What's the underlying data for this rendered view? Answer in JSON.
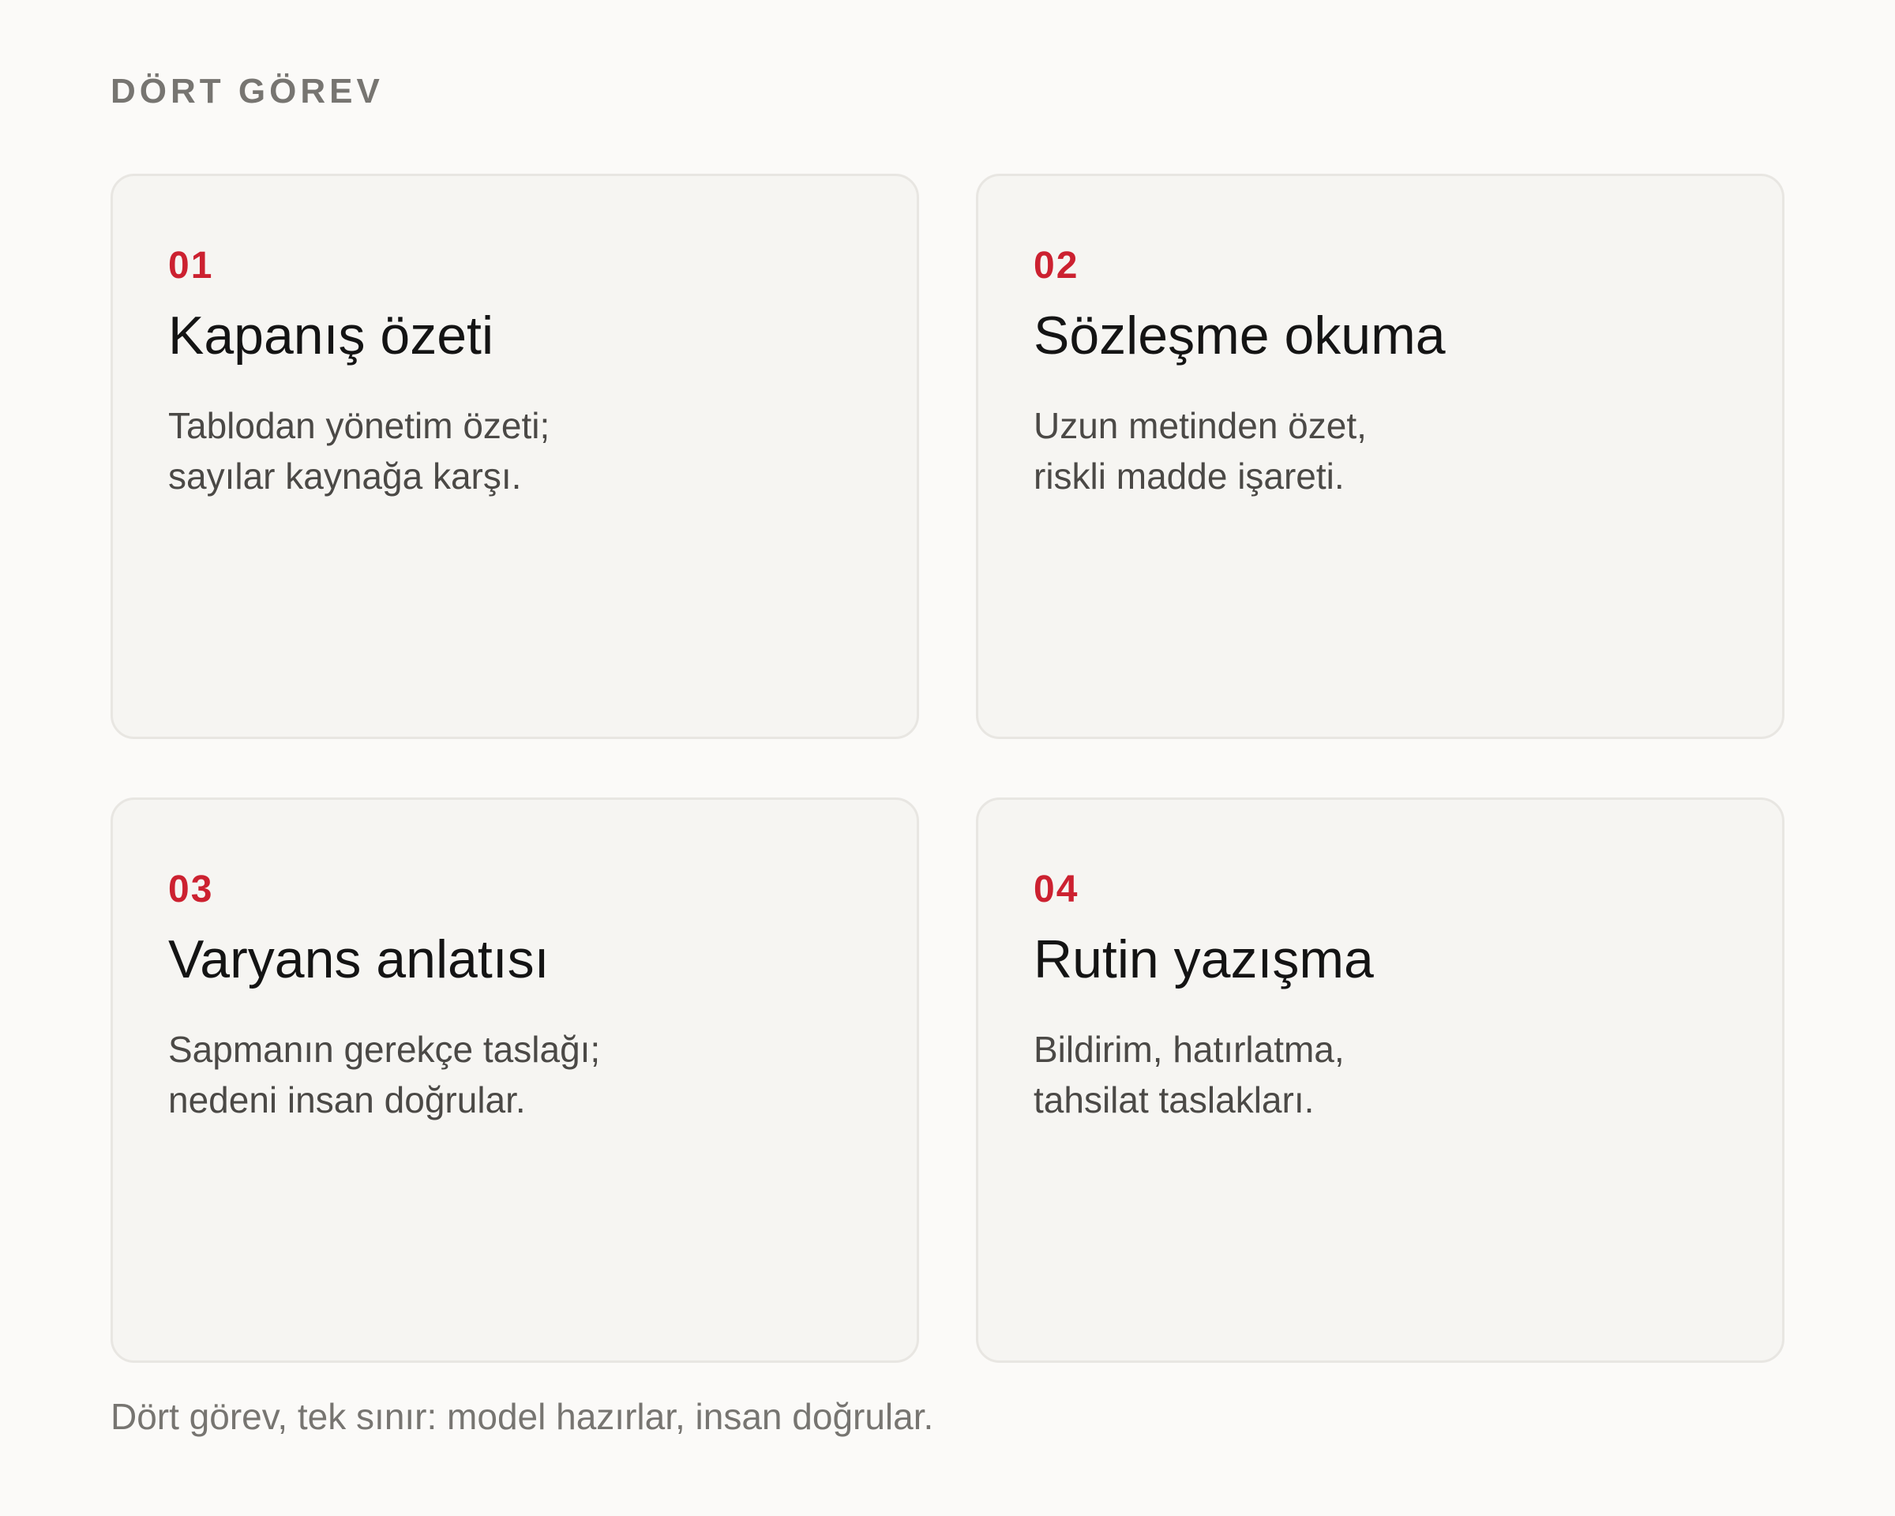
{
  "eyebrow": "DÖRT GÖREV",
  "cards": [
    {
      "number": "01",
      "title": "Kapanış özeti",
      "description": [
        "Tablodan yönetim özeti;",
        "sayılar kaynağa karşı."
      ]
    },
    {
      "number": "02",
      "title": "Sözleşme okuma",
      "description": [
        "Uzun metinden özet,",
        "riskli madde işareti."
      ]
    },
    {
      "number": "03",
      "title": "Varyans anlatısı",
      "description": [
        "Sapmanın gerekçe taslağı;",
        "nedeni insan doğrular."
      ]
    },
    {
      "number": "04",
      "title": "Rutin yazışma",
      "description": [
        "Bildirim, hatırlatma,",
        "tahsilat taslakları."
      ]
    }
  ],
  "footer": "Dört görev, tek sınır: model hazırlar, insan doğrular.",
  "colors": {
    "background": "#fbfaf8",
    "card": "#f6f5f2",
    "accent": "#cc2130"
  }
}
